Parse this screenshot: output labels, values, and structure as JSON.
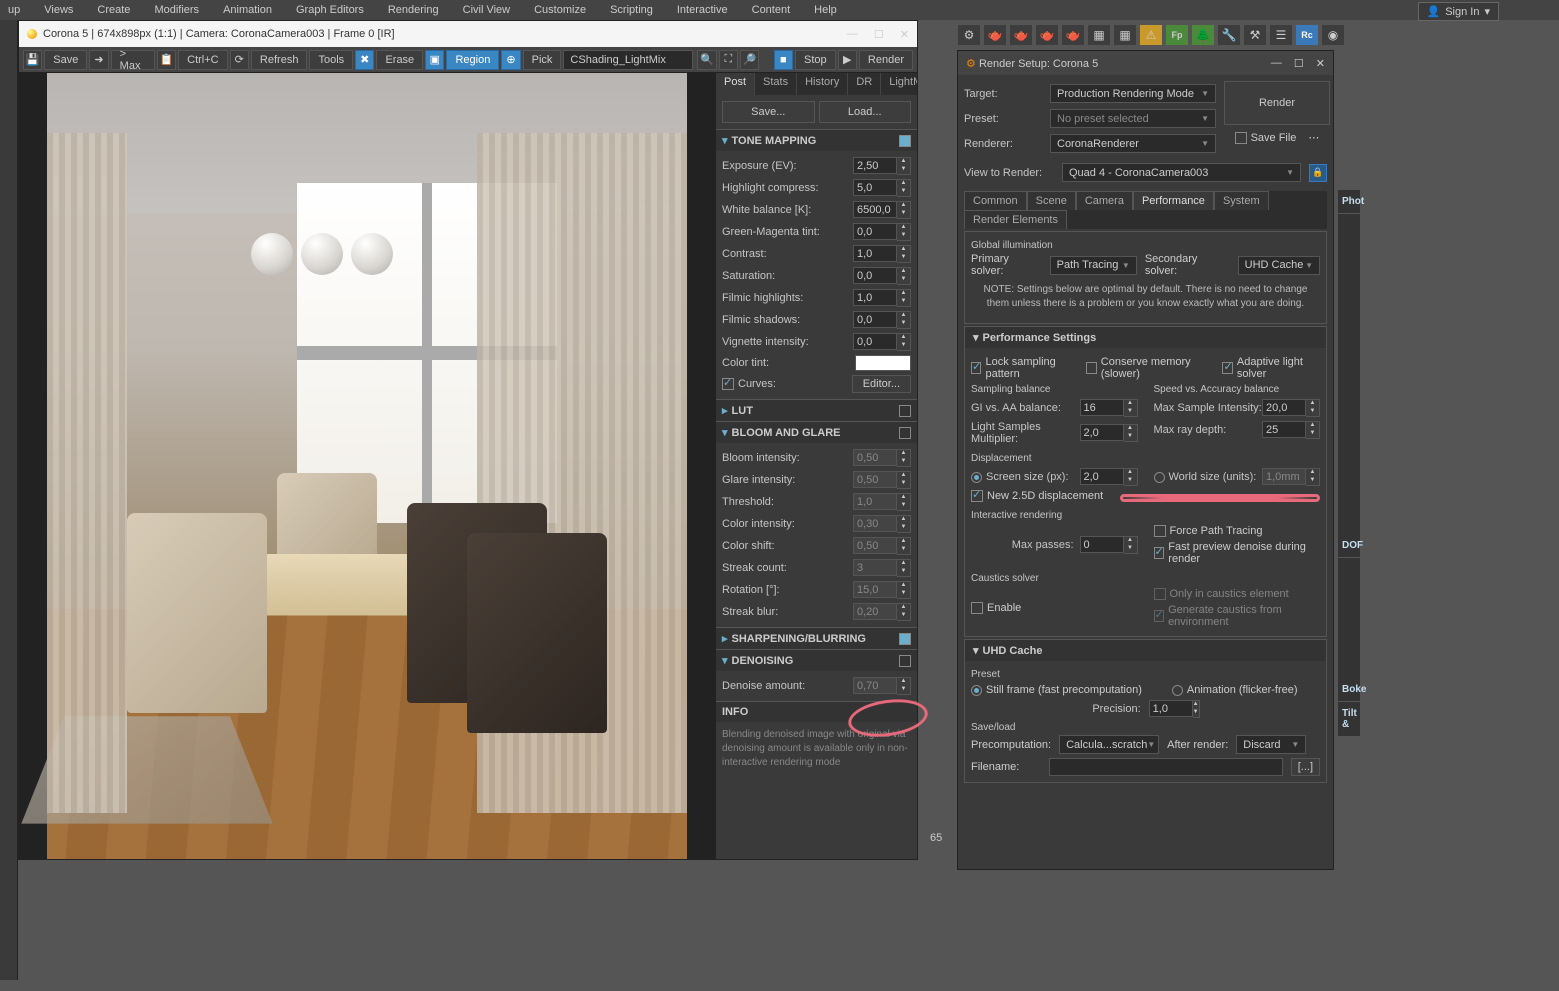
{
  "menubar": [
    "up",
    "Views",
    "Create",
    "Modifiers",
    "Animation",
    "Graph Editors",
    "Rendering",
    "Civil View",
    "Customize",
    "Scripting",
    "Interactive",
    "Content",
    "Help"
  ],
  "signin": "Sign In",
  "vfb": {
    "title": "Corona 5 | 674x898px (1:1) | Camera: CoronaCamera003 | Frame 0 [IR]",
    "toolbar": {
      "save": "Save",
      "tomax": "> Max",
      "ctrlc": "Ctrl+C",
      "refresh": "Refresh",
      "tools": "Tools",
      "erase": "Erase",
      "region": "Region",
      "pick": "Pick",
      "input": "CShading_LightMix",
      "stop": "Stop",
      "render": "Render"
    },
    "tabs": [
      "Post",
      "Stats",
      "History",
      "DR",
      "LightMix"
    ],
    "buttons": {
      "save": "Save...",
      "load": "Load..."
    },
    "tone": {
      "title": "TONE MAPPING",
      "exposure": {
        "l": "Exposure (EV):",
        "v": "2,50"
      },
      "highlight": {
        "l": "Highlight compress:",
        "v": "5,0"
      },
      "wb": {
        "l": "White balance [K]:",
        "v": "6500,0"
      },
      "gm": {
        "l": "Green-Magenta tint:",
        "v": "0,0"
      },
      "contrast": {
        "l": "Contrast:",
        "v": "1,0"
      },
      "sat": {
        "l": "Saturation:",
        "v": "0,0"
      },
      "fh": {
        "l": "Filmic highlights:",
        "v": "1,0"
      },
      "fs": {
        "l": "Filmic shadows:",
        "v": "0,0"
      },
      "vig": {
        "l": "Vignette intensity:",
        "v": "0,0"
      },
      "tint": {
        "l": "Color tint:"
      },
      "curves": {
        "l": "Curves:",
        "btn": "Editor..."
      }
    },
    "lut": {
      "title": "LUT"
    },
    "bloom": {
      "title": "BLOOM AND GLARE",
      "bi": {
        "l": "Bloom intensity:",
        "v": "0,50"
      },
      "gi": {
        "l": "Glare intensity:",
        "v": "0,50"
      },
      "th": {
        "l": "Threshold:",
        "v": "1,0"
      },
      "ci": {
        "l": "Color intensity:",
        "v": "0,30"
      },
      "cs": {
        "l": "Color shift:",
        "v": "0,50"
      },
      "sc": {
        "l": "Streak count:",
        "v": "3"
      },
      "rot": {
        "l": "Rotation [°]:",
        "v": "15,0"
      },
      "sb": {
        "l": "Streak blur:",
        "v": "0,20"
      }
    },
    "sharp": {
      "title": "SHARPENING/BLURRING"
    },
    "denoise": {
      "title": "DENOISING",
      "da": {
        "l": "Denoise amount:",
        "v": "0,70"
      }
    },
    "info": {
      "title": "INFO",
      "text": "Blending denoised image with original via denoising amount is available only in non-interactive rendering mode"
    }
  },
  "rs": {
    "title": "Render Setup: Corona 5",
    "target": {
      "l": "Target:",
      "v": "Production Rendering Mode"
    },
    "preset": {
      "l": "Preset:",
      "v": "No preset selected"
    },
    "renderer": {
      "l": "Renderer:",
      "v": "CoronaRenderer"
    },
    "savefile": "Save File",
    "render": "Render",
    "vtr": {
      "l": "View to Render:",
      "v": "Quad 4 - CoronaCamera003"
    },
    "tabs": [
      "Common",
      "Scene",
      "Camera",
      "Performance",
      "System",
      "Render Elements"
    ],
    "gi": {
      "title": "Global illumination",
      "ps": {
        "l": "Primary solver:",
        "v": "Path Tracing"
      },
      "ss": {
        "l": "Secondary solver:",
        "v": "UHD Cache"
      },
      "note": "NOTE: Settings below are optimal by default. There is no need to change them unless there is a problem or you know exactly what you are doing."
    },
    "perf": {
      "title": "Performance Settings",
      "lock": "Lock sampling pattern",
      "cons": "Conserve memory (slower)",
      "als": "Adaptive light solver",
      "sb": "Sampling balance",
      "sab": "Speed vs. Accuracy balance",
      "gi": {
        "l": "GI vs. AA balance:",
        "v": "16"
      },
      "msi": {
        "l": "Max Sample Intensity:",
        "v": "20,0"
      },
      "lsm": {
        "l": "Light Samples Multiplier:",
        "v": "2,0"
      },
      "mrd": {
        "l": "Max ray depth:",
        "v": "25"
      },
      "disp": "Displacement",
      "ssz": {
        "l": "Screen size (px):",
        "v": "2,0"
      },
      "wsz": {
        "l": "World size (units):",
        "v": "1,0mm"
      },
      "n25d": "New 2.5D displacement",
      "ir": "Interactive rendering",
      "mp": {
        "l": "Max passes:",
        "v": "0"
      },
      "fpt": "Force Path Tracing",
      "fpd": "Fast preview denoise during render",
      "caus": "Caustics solver",
      "en": "Enable",
      "oce": "Only in caustics element",
      "gce": "Generate caustics from environment"
    },
    "uhd": {
      "title": "UHD Cache",
      "preset": "Preset",
      "still": "Still frame (fast precomputation)",
      "anim": "Animation (flicker-free)",
      "prec": {
        "l": "Precision:",
        "v": "1,0"
      },
      "sl": "Save/load",
      "precomp": {
        "l": "Precomputation:",
        "v": "Calcula...scratch"
      },
      "after": {
        "l": "After render:",
        "v": "Discard"
      },
      "fn": {
        "l": "Filename:"
      }
    }
  },
  "rc": [
    "Phot",
    "DOF",
    "Boke",
    "Tilt &"
  ],
  "bottom_num": "65"
}
